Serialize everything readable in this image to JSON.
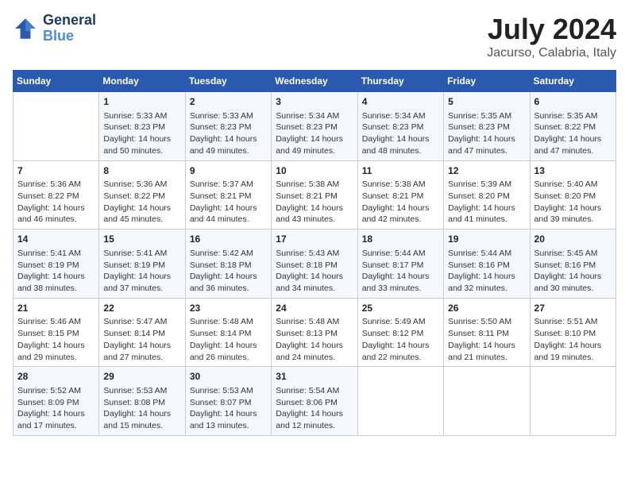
{
  "header": {
    "logo_line1": "General",
    "logo_line2": "Blue",
    "title": "July 2024",
    "subtitle": "Jacurso, Calabria, Italy"
  },
  "calendar": {
    "days_of_week": [
      "Sunday",
      "Monday",
      "Tuesday",
      "Wednesday",
      "Thursday",
      "Friday",
      "Saturday"
    ],
    "weeks": [
      [
        {
          "day": "",
          "info": ""
        },
        {
          "day": "1",
          "info": "Sunrise: 5:33 AM\nSunset: 8:23 PM\nDaylight: 14 hours\nand 50 minutes."
        },
        {
          "day": "2",
          "info": "Sunrise: 5:33 AM\nSunset: 8:23 PM\nDaylight: 14 hours\nand 49 minutes."
        },
        {
          "day": "3",
          "info": "Sunrise: 5:34 AM\nSunset: 8:23 PM\nDaylight: 14 hours\nand 49 minutes."
        },
        {
          "day": "4",
          "info": "Sunrise: 5:34 AM\nSunset: 8:23 PM\nDaylight: 14 hours\nand 48 minutes."
        },
        {
          "day": "5",
          "info": "Sunrise: 5:35 AM\nSunset: 8:23 PM\nDaylight: 14 hours\nand 47 minutes."
        },
        {
          "day": "6",
          "info": "Sunrise: 5:35 AM\nSunset: 8:22 PM\nDaylight: 14 hours\nand 47 minutes."
        }
      ],
      [
        {
          "day": "7",
          "info": "Sunrise: 5:36 AM\nSunset: 8:22 PM\nDaylight: 14 hours\nand 46 minutes."
        },
        {
          "day": "8",
          "info": "Sunrise: 5:36 AM\nSunset: 8:22 PM\nDaylight: 14 hours\nand 45 minutes."
        },
        {
          "day": "9",
          "info": "Sunrise: 5:37 AM\nSunset: 8:21 PM\nDaylight: 14 hours\nand 44 minutes."
        },
        {
          "day": "10",
          "info": "Sunrise: 5:38 AM\nSunset: 8:21 PM\nDaylight: 14 hours\nand 43 minutes."
        },
        {
          "day": "11",
          "info": "Sunrise: 5:38 AM\nSunset: 8:21 PM\nDaylight: 14 hours\nand 42 minutes."
        },
        {
          "day": "12",
          "info": "Sunrise: 5:39 AM\nSunset: 8:20 PM\nDaylight: 14 hours\nand 41 minutes."
        },
        {
          "day": "13",
          "info": "Sunrise: 5:40 AM\nSunset: 8:20 PM\nDaylight: 14 hours\nand 39 minutes."
        }
      ],
      [
        {
          "day": "14",
          "info": "Sunrise: 5:41 AM\nSunset: 8:19 PM\nDaylight: 14 hours\nand 38 minutes."
        },
        {
          "day": "15",
          "info": "Sunrise: 5:41 AM\nSunset: 8:19 PM\nDaylight: 14 hours\nand 37 minutes."
        },
        {
          "day": "16",
          "info": "Sunrise: 5:42 AM\nSunset: 8:18 PM\nDaylight: 14 hours\nand 36 minutes."
        },
        {
          "day": "17",
          "info": "Sunrise: 5:43 AM\nSunset: 8:18 PM\nDaylight: 14 hours\nand 34 minutes."
        },
        {
          "day": "18",
          "info": "Sunrise: 5:44 AM\nSunset: 8:17 PM\nDaylight: 14 hours\nand 33 minutes."
        },
        {
          "day": "19",
          "info": "Sunrise: 5:44 AM\nSunset: 8:16 PM\nDaylight: 14 hours\nand 32 minutes."
        },
        {
          "day": "20",
          "info": "Sunrise: 5:45 AM\nSunset: 8:16 PM\nDaylight: 14 hours\nand 30 minutes."
        }
      ],
      [
        {
          "day": "21",
          "info": "Sunrise: 5:46 AM\nSunset: 8:15 PM\nDaylight: 14 hours\nand 29 minutes."
        },
        {
          "day": "22",
          "info": "Sunrise: 5:47 AM\nSunset: 8:14 PM\nDaylight: 14 hours\nand 27 minutes."
        },
        {
          "day": "23",
          "info": "Sunrise: 5:48 AM\nSunset: 8:14 PM\nDaylight: 14 hours\nand 26 minutes."
        },
        {
          "day": "24",
          "info": "Sunrise: 5:48 AM\nSunset: 8:13 PM\nDaylight: 14 hours\nand 24 minutes."
        },
        {
          "day": "25",
          "info": "Sunrise: 5:49 AM\nSunset: 8:12 PM\nDaylight: 14 hours\nand 22 minutes."
        },
        {
          "day": "26",
          "info": "Sunrise: 5:50 AM\nSunset: 8:11 PM\nDaylight: 14 hours\nand 21 minutes."
        },
        {
          "day": "27",
          "info": "Sunrise: 5:51 AM\nSunset: 8:10 PM\nDaylight: 14 hours\nand 19 minutes."
        }
      ],
      [
        {
          "day": "28",
          "info": "Sunrise: 5:52 AM\nSunset: 8:09 PM\nDaylight: 14 hours\nand 17 minutes."
        },
        {
          "day": "29",
          "info": "Sunrise: 5:53 AM\nSunset: 8:08 PM\nDaylight: 14 hours\nand 15 minutes."
        },
        {
          "day": "30",
          "info": "Sunrise: 5:53 AM\nSunset: 8:07 PM\nDaylight: 14 hours\nand 13 minutes."
        },
        {
          "day": "31",
          "info": "Sunrise: 5:54 AM\nSunset: 8:06 PM\nDaylight: 14 hours\nand 12 minutes."
        },
        {
          "day": "",
          "info": ""
        },
        {
          "day": "",
          "info": ""
        },
        {
          "day": "",
          "info": ""
        }
      ]
    ]
  }
}
